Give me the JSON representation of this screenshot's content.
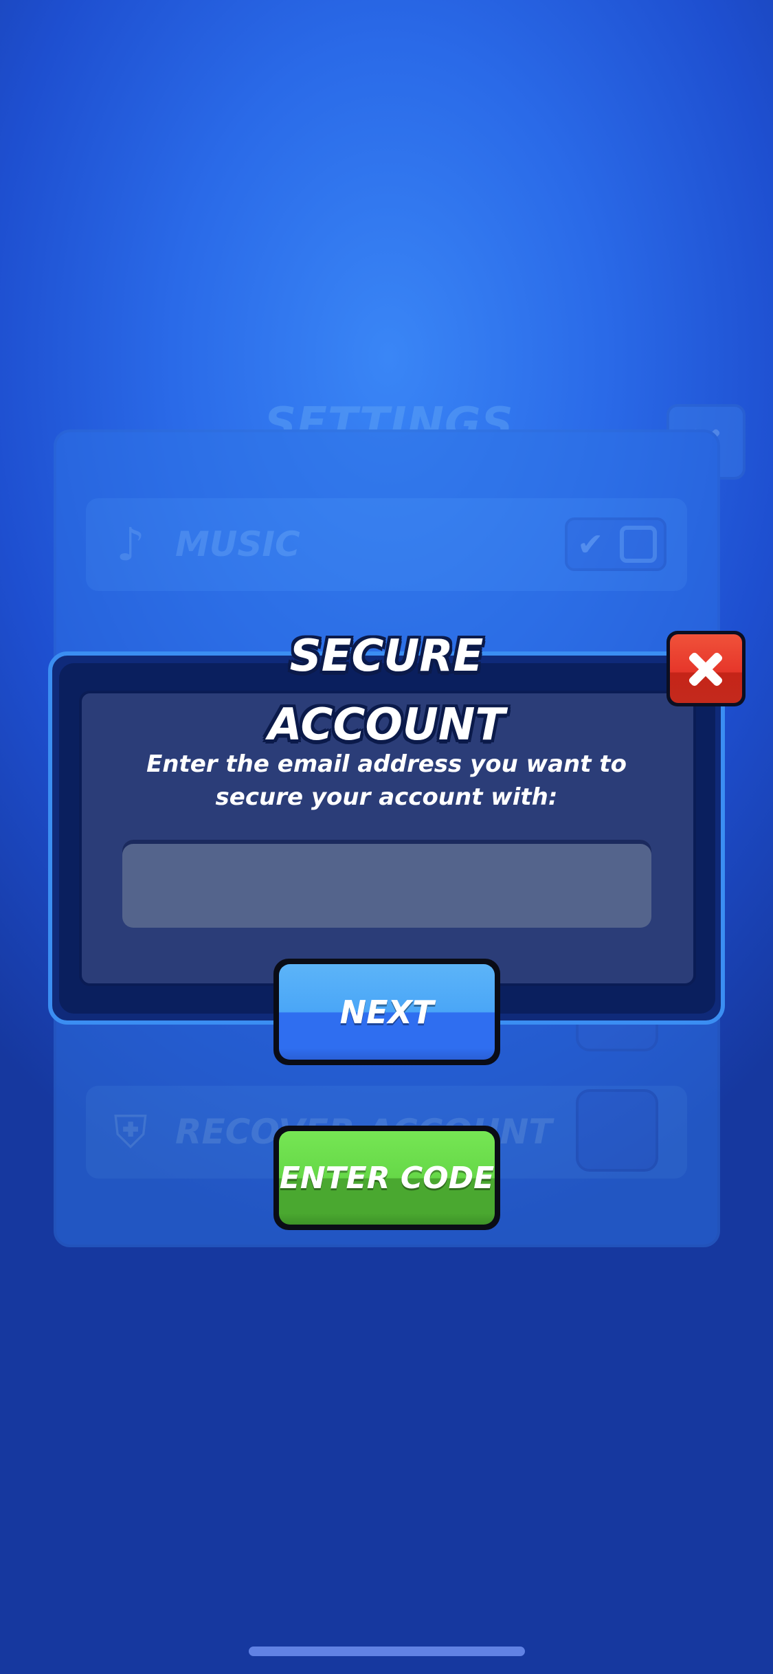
{
  "background": {
    "title": "SETTINGS",
    "rows": [
      {
        "label": "MUSIC",
        "icon": "music-note-icon"
      },
      {
        "label": "RECOVER ACCOUNT",
        "icon": "shield-icon"
      }
    ]
  },
  "modal": {
    "title": "SECURE ACCOUNT",
    "prompt": "Enter the email address you want to secure your account with:",
    "email_value": "",
    "email_placeholder": ""
  },
  "buttons": {
    "next_label": "NEXT",
    "enter_code_label": "ENTER CODE"
  },
  "colors": {
    "next_button": "#2f6ef0",
    "enter_code_button": "#4aa830",
    "close_button": "#e6362a",
    "modal_body": "#2b3d78"
  }
}
